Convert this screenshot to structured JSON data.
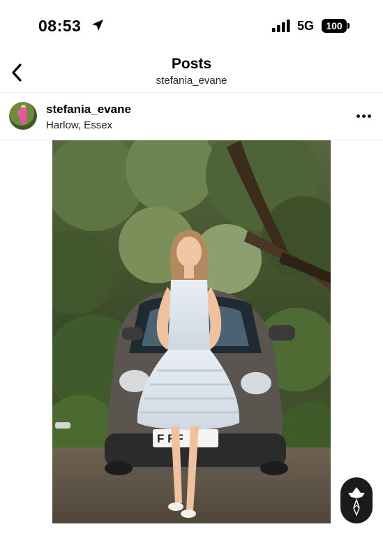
{
  "status_bar": {
    "time": "08:53",
    "location_icon": "location-arrow-icon",
    "signal_icon": "cellular-signal-icon",
    "network": "5G",
    "battery": "100"
  },
  "header": {
    "back_icon": "chevron-left-icon",
    "title": "Posts",
    "subtitle": "stefania_evane"
  },
  "post": {
    "username": "stefania_evane",
    "location": "Harlow, Essex",
    "more_icon": "more-horizontal-icon",
    "image_description_icon": "photo"
  },
  "watermark": {
    "icon": "diamond-logo-icon"
  }
}
